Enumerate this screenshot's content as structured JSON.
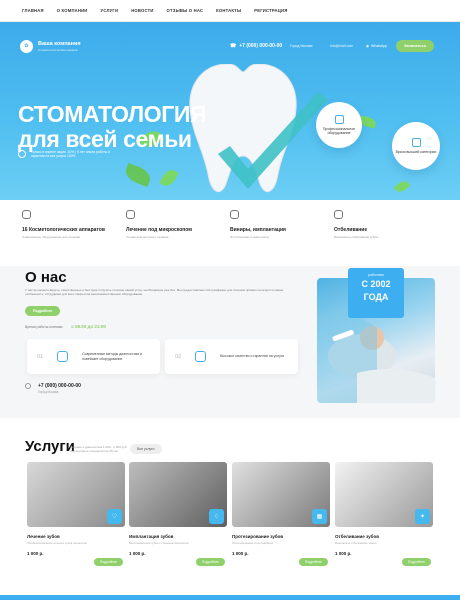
{
  "nav": [
    "Главная",
    "О компании",
    "Услуги",
    "Новости",
    "Отзывы о нас",
    "Контакты",
    "Регистрация"
  ],
  "header": {
    "brand": "Ваша компания",
    "tagline": "Стоматологическая клиника",
    "phone": "+7 (000) 000-00-00",
    "city": "Город Москва",
    "email": "info@mail.com",
    "whatsapp": "WhatsApp",
    "cta": "Записаться"
  },
  "hero": {
    "title_line1": "СТОМАТОЛОГИЯ",
    "title_line2": "для всей семьи",
    "note": "Только в апреле акция -10% | 5 лет опыта работы и гарантии на все услуги 100%",
    "bubble1": "Профессиональное оборудование",
    "bubble2": "Врачи высшей категории"
  },
  "features": [
    {
      "title": "16 Косметологических аппаратов",
      "sub": "Современное оборудование для лечения"
    },
    {
      "title": "Лечение под микроскопом",
      "sub": "Точная диагностика и лечение"
    },
    {
      "title": "Виниры, имплантация",
      "sub": "Эстетическая стоматология"
    },
    {
      "title": "Отбеливание",
      "sub": "Безопасное отбеливание зубов"
    }
  ],
  "about": {
    "title": "О нас",
    "text": "У нас вы можете видеть, качественные и быстрые получить лечение самой услуг, необходимую уже без. Мы предоставляем обслуживание для лечения прямых пользуется самое особенность, сотрудники для всех пациентов высококачественное оборудование.",
    "more": "Подробнее",
    "hours_label": "Время работы клиники:",
    "hours": "с 08.00 до 21:00",
    "card1": "Современные методы диагностики и новейшее оборудование",
    "card2": "Высокое качество и гарантия на услуги",
    "num1": "01",
    "num2": "02",
    "phone": "+7 (000) 000-00-00",
    "city": "Город Москва",
    "since_small": "работаем",
    "since_big1": "С 2002",
    "since_big2": "ГОДА"
  },
  "services": {
    "title": "Услуги",
    "note": "Лечение и диагностика 1 000 - 2 000 руб. под контроль специалистов 15 лет",
    "all": "Все услуги",
    "items": [
      {
        "title": "Лечение зубов",
        "sub": "Профессиональное лечение зубов пациентов",
        "price": "1 000 р.",
        "btn": "Подробнее"
      },
      {
        "title": "Имплантация зубов",
        "sub": "Восстановление зубов с помощью имплантов",
        "price": "1 000 р.",
        "btn": "Подробнее"
      },
      {
        "title": "Протезирование зубов",
        "sub": "Протезирование и реставрация",
        "price": "1 000 р.",
        "btn": "Подробнее"
      },
      {
        "title": "Отбеливание зубов",
        "sub": "Безопасное отбеливание эмали",
        "price": "1 000 р.",
        "btn": "Подробнее"
      }
    ]
  },
  "colors": {
    "accent": "#3daef0",
    "green": "#8fd06a"
  }
}
